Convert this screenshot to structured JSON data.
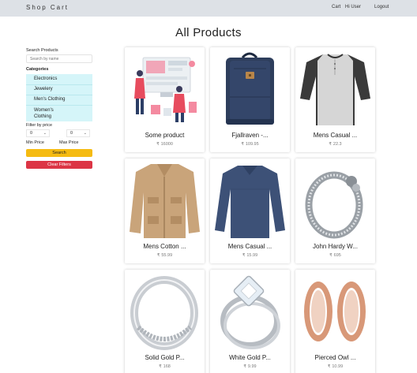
{
  "navbar": {
    "brand": "Shop Cart",
    "links": [
      "Cart",
      "Hi User",
      "Logout"
    ]
  },
  "page_title": "All Products",
  "sidebar": {
    "search_label": "Search Products",
    "search_placeholder": "Search by name",
    "categories_label": "Categories",
    "categories": [
      "Electronics",
      "Jewelery",
      "Men's Clothing",
      "Women's",
      "Clothing"
    ],
    "filter_label": "Filter by price",
    "min_value": "0",
    "max_value": "0",
    "min_label": "Min Price",
    "max_label": "Max Price",
    "search_button": "Search",
    "clear_button": "Clear Filters"
  },
  "products": [
    {
      "name": "Some product",
      "currency": "₹",
      "price": "16000"
    },
    {
      "name": "Fjallraven -...",
      "currency": "₹",
      "price": "109.95"
    },
    {
      "name": "Mens Casual ...",
      "currency": "₹",
      "price": "22.3"
    },
    {
      "name": "Mens Cotton ...",
      "currency": "₹",
      "price": "55.99"
    },
    {
      "name": "Mens Casual ...",
      "currency": "₹",
      "price": "15.99"
    },
    {
      "name": "John Hardy W...",
      "currency": "₹",
      "price": "695"
    },
    {
      "name": "Solid Gold P...",
      "currency": "₹",
      "price": "168"
    },
    {
      "name": "White Gold P...",
      "currency": "₹",
      "price": "9.99"
    },
    {
      "name": "Pierced Owl ...",
      "currency": "₹",
      "price": "10.99"
    }
  ],
  "colors": {
    "navbar_bg": "#dde1e6",
    "category_bg": "#d5f5f9",
    "search_button": "#f5bb12",
    "clear_button": "#dc3545"
  }
}
